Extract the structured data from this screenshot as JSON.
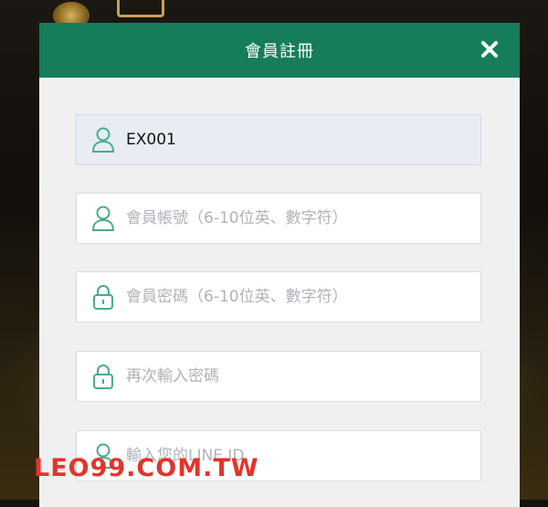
{
  "modal": {
    "title": "會員註冊",
    "close_icon": "close-icon"
  },
  "form": {
    "fields": [
      {
        "icon": "user-icon",
        "value": "EX001",
        "placeholder": ""
      },
      {
        "icon": "user-icon",
        "value": "",
        "placeholder": "會員帳號（6-10位英、數字符）"
      },
      {
        "icon": "lock-icon",
        "value": "",
        "placeholder": "會員密碼（6-10位英、數字符）"
      },
      {
        "icon": "lock-icon",
        "value": "",
        "placeholder": "再次輸入密碼"
      },
      {
        "icon": "user-icon",
        "value": "",
        "placeholder": "輸入您的LINE ID"
      }
    ]
  },
  "watermark": "LEO99.COM.TW",
  "colors": {
    "header": "#157d5b",
    "icon": "#4aab8c",
    "watermark": "#e3342b"
  }
}
